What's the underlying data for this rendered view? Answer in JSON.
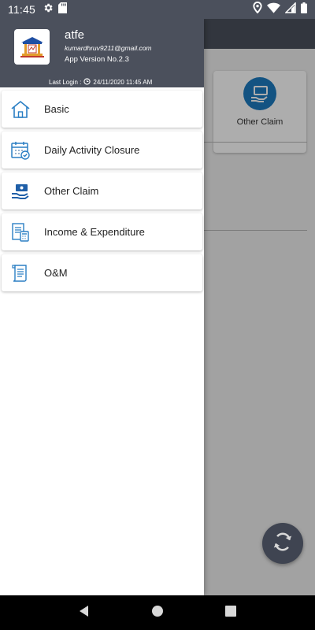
{
  "status_bar": {
    "time": "11:45",
    "icons": [
      "gear-icon",
      "sd-card-icon",
      "location-icon",
      "wifi-icon",
      "battery-icon"
    ]
  },
  "background_app": {
    "card_label": "Other Claim",
    "accent": "#1c7bc0",
    "fab_icon": "sync-icon"
  },
  "drawer": {
    "header": {
      "logo_icon": "institution-logo-icon",
      "user_name": "atfe",
      "email": "kumardhruv9211@gmail.com",
      "app_version": "App Version No.2.3",
      "last_login_label": "Last Login :",
      "last_login_value": "24/11/2020 11:45 AM"
    },
    "menu_items": [
      {
        "label": "Basic",
        "icon": "home-icon"
      },
      {
        "label": "Daily Activity Closure",
        "icon": "calendar-check-icon"
      },
      {
        "label": "Other Claim",
        "icon": "hand-money-icon"
      },
      {
        "label": "Income & Expenditure",
        "icon": "ledger-calculator-icon"
      },
      {
        "label": "O&M",
        "icon": "scroll-document-icon"
      }
    ]
  },
  "nav_bar": {
    "buttons": [
      "back-icon",
      "home-circle-icon",
      "recents-icon"
    ]
  },
  "colors": {
    "header_bg": "#4b505c",
    "icon_blue": "#2b7fc4"
  }
}
